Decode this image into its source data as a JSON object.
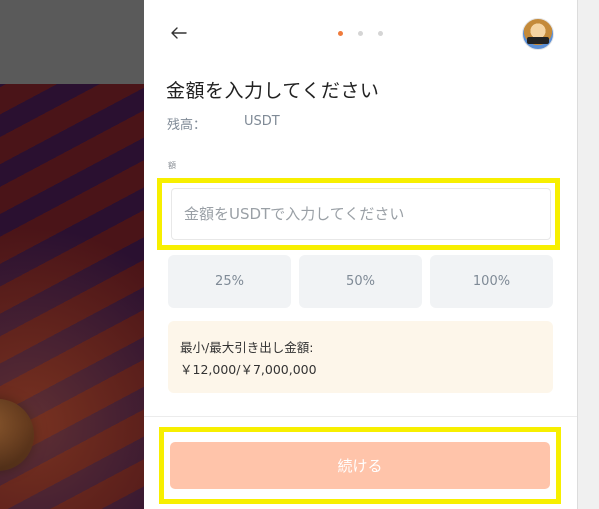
{
  "header": {
    "back_icon": "arrow-left-icon",
    "step_dots": [
      true,
      false,
      false
    ],
    "accent_color": "#ef7b3c"
  },
  "form": {
    "title": "金額を入力してください",
    "balance_label": "残高：",
    "balance_currency": "USDT",
    "amount_label": "額",
    "amount_placeholder": "金額をUSDTで入力してください",
    "amount_value": ""
  },
  "percent_buttons": [
    {
      "label": "25%"
    },
    {
      "label": "50%"
    },
    {
      "label": "100%"
    }
  ],
  "limits": {
    "label": "最小/最大引き出し金額:",
    "range": "￥12,000/￥7,000,000"
  },
  "footer": {
    "continue_label": "続ける",
    "continue_color": "#ffc4aa"
  },
  "highlight_color": "#f7ef00"
}
